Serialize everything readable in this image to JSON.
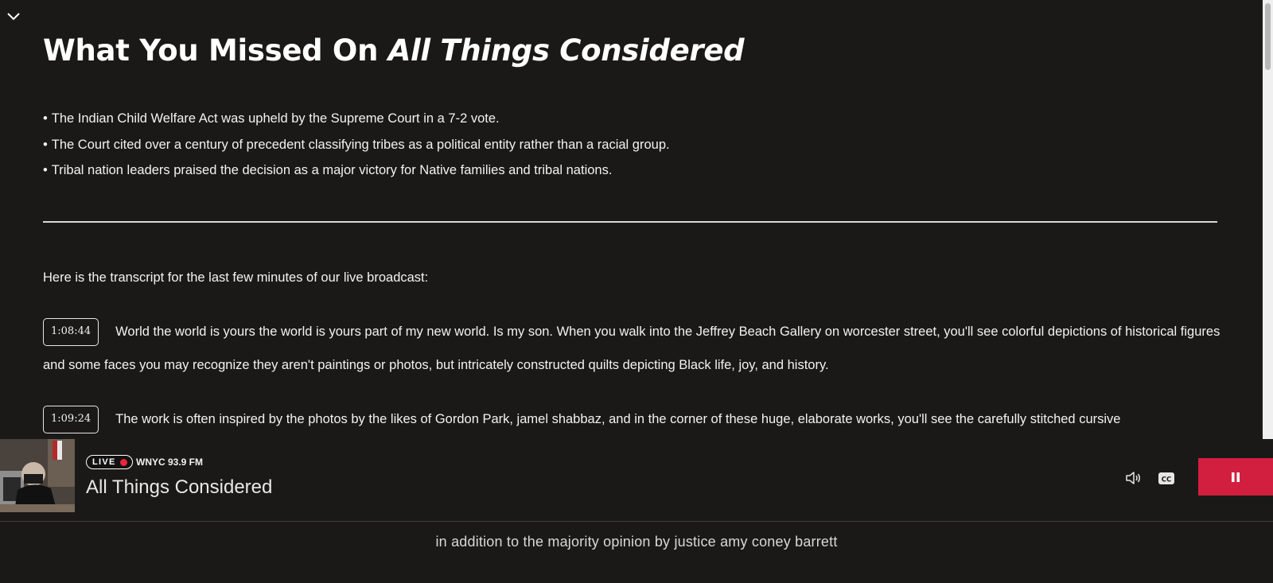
{
  "article": {
    "headline_plain": "What You Missed On ",
    "headline_italic": "All Things Considered",
    "bullets": [
      "The Indian Child Welfare Act was upheld by the Supreme Court in a 7-2 vote.",
      "The Court cited over a century of precedent classifying tribes as a political entity rather than a racial group.",
      "Tribal nation leaders praised the decision as a major victory for Native families and tribal nations."
    ],
    "transcript_intro": "Here is the transcript for the last few minutes of our live broadcast:",
    "segments": [
      {
        "timestamp": "1:08:44",
        "text": "World the world is yours the world is yours part of my new world. Is my son. When you walk into the Jeffrey Beach Gallery on worcester street, you'll see colorful depictions of historical figures and some faces you may recognize they aren't paintings or photos, but intricately constructed quilts depicting Black life, joy, and history."
      },
      {
        "timestamp": "1:09:24",
        "text": "The work is often inspired by the photos by the likes of Gordon Park, jamel shabbaz, and in the corner of these huge, elaborate works, you'll see the carefully stitched cursive"
      }
    ]
  },
  "player": {
    "live_label": "LIVE",
    "station": "WNYC 93.9 FM",
    "show_title": "All Things Considered",
    "cc_label": "CC"
  },
  "captions": {
    "current_text": "in addition to the majority opinion by justice amy coney barrett"
  },
  "colors": {
    "background": "#1b1918",
    "accent_red": "#d31f3f",
    "live_dot": "#e8253a"
  },
  "icons": [
    "chevron-down-icon",
    "live-dot-icon",
    "volume-icon",
    "closed-captions-icon",
    "pause-icon"
  ]
}
